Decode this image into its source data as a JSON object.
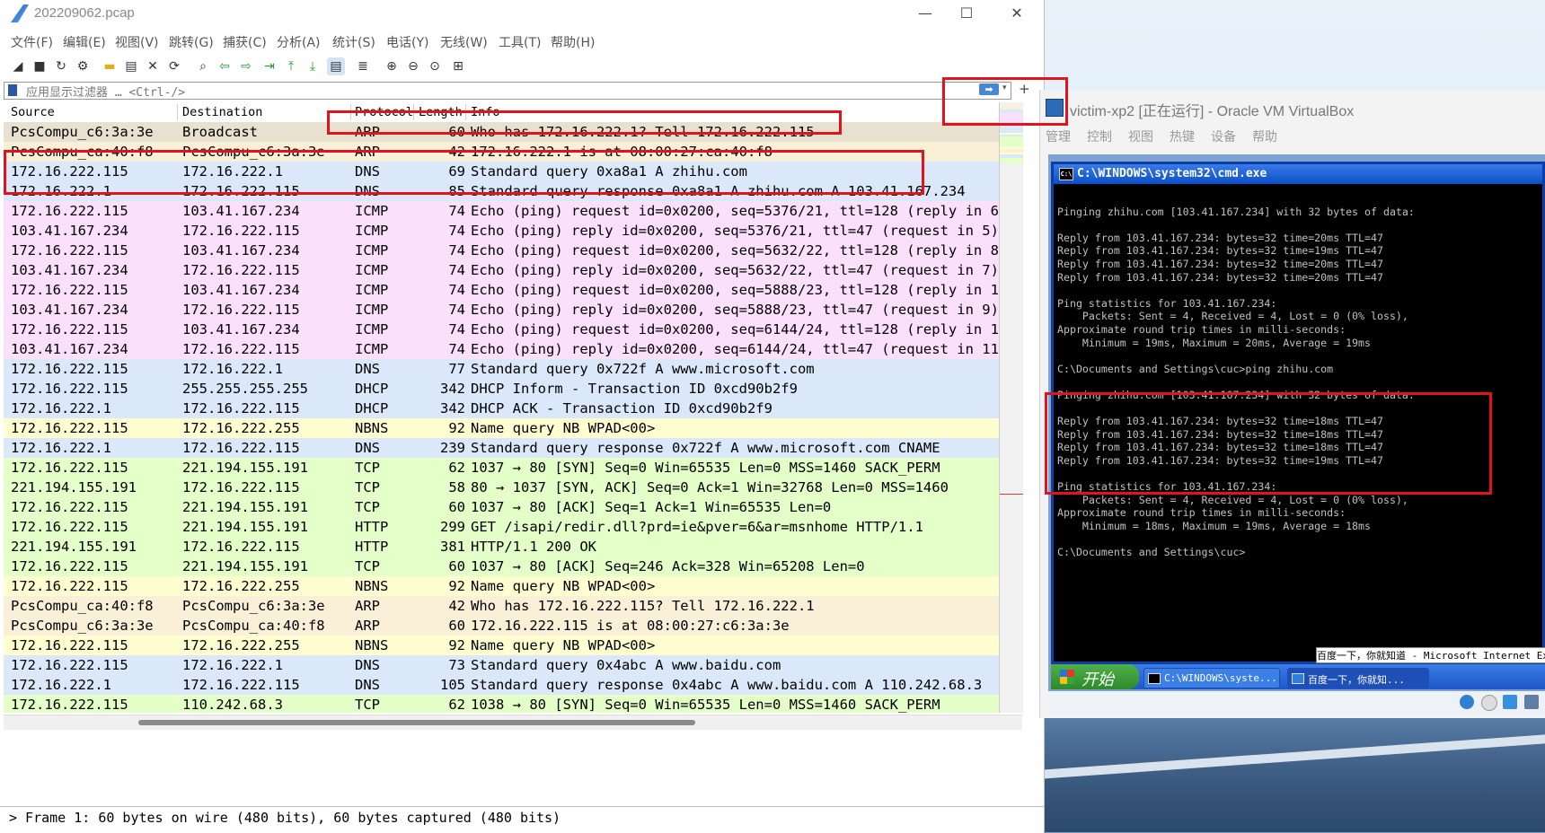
{
  "wireshark": {
    "title": "202209062.pcap",
    "window_controls": {
      "minimize": "—",
      "maximize": "☐",
      "close": "✕"
    },
    "menu": [
      "文件(F)",
      "编辑(E)",
      "视图(V)",
      "跳转(G)",
      "捕获(C)",
      "分析(A)",
      "统计(S)",
      "电话(Y)",
      "无线(W)",
      "工具(T)",
      "帮助(H)"
    ],
    "toolbar_icons": [
      "shark-fin-start-icon",
      "stop-icon",
      "restart-icon",
      "options-gear-icon",
      "open-folder-icon",
      "save-file-icon",
      "close-file-icon",
      "reload-icon",
      "find-icon",
      "go-back-icon",
      "go-forward-icon",
      "go-to-packet-icon",
      "first-packet-icon",
      "last-packet-icon",
      "autoscroll-icon",
      "colorize-icon",
      "zoom-in-icon",
      "zoom-out-icon",
      "zoom-normal-icon",
      "resize-columns-icon"
    ],
    "filter": {
      "placeholder": "应用显示过滤器 … <Ctrl-/>",
      "apply_label": "➡",
      "plus": "+"
    },
    "columns": {
      "source": "Source",
      "destination": "Destination",
      "protocol": "Protocol",
      "length": "Length",
      "info": "Info"
    },
    "rows": [
      {
        "src": "PcsCompu_c6:3a:3e",
        "dst": "Broadcast",
        "proto": "ARP",
        "len": "60",
        "info": "Who has 172.16.222.1? Tell 172.16.222.115",
        "color": "#faf0d7"
      },
      {
        "src": "PcsCompu_ca:40:f8",
        "dst": "PcsCompu_c6:3a:3e",
        "proto": "ARP",
        "len": "42",
        "info": "172.16.222.1 is at 08:00:27:ca:40:f8",
        "color": "#faf0d7"
      },
      {
        "src": "172.16.222.115",
        "dst": "172.16.222.1",
        "proto": "DNS",
        "len": "69",
        "info": "Standard query 0xa8a1 A zhihu.com",
        "color": "#dae8f9"
      },
      {
        "src": "172.16.222.1",
        "dst": "172.16.222.115",
        "proto": "DNS",
        "len": "85",
        "info": "Standard query response 0xa8a1 A zhihu.com A 103.41.167.234",
        "color": "#dae8f9"
      },
      {
        "src": "172.16.222.115",
        "dst": "103.41.167.234",
        "proto": "ICMP",
        "len": "74",
        "info": "Echo (ping) request  id=0x0200, seq=5376/21, ttl=128 (reply in 6)",
        "color": "#fbe0fb"
      },
      {
        "src": "103.41.167.234",
        "dst": "172.16.222.115",
        "proto": "ICMP",
        "len": "74",
        "info": "Echo (ping) reply    id=0x0200, seq=5376/21, ttl=47 (request in 5)",
        "color": "#fbe0fb"
      },
      {
        "src": "172.16.222.115",
        "dst": "103.41.167.234",
        "proto": "ICMP",
        "len": "74",
        "info": "Echo (ping) request  id=0x0200, seq=5632/22, ttl=128 (reply in 8)",
        "color": "#fbe0fb"
      },
      {
        "src": "103.41.167.234",
        "dst": "172.16.222.115",
        "proto": "ICMP",
        "len": "74",
        "info": "Echo (ping) reply    id=0x0200, seq=5632/22, ttl=47 (request in 7)",
        "color": "#fbe0fb"
      },
      {
        "src": "172.16.222.115",
        "dst": "103.41.167.234",
        "proto": "ICMP",
        "len": "74",
        "info": "Echo (ping) request  id=0x0200, seq=5888/23, ttl=128 (reply in 10)",
        "color": "#fbe0fb"
      },
      {
        "src": "103.41.167.234",
        "dst": "172.16.222.115",
        "proto": "ICMP",
        "len": "74",
        "info": "Echo (ping) reply    id=0x0200, seq=5888/23, ttl=47 (request in 9)",
        "color": "#fbe0fb"
      },
      {
        "src": "172.16.222.115",
        "dst": "103.41.167.234",
        "proto": "ICMP",
        "len": "74",
        "info": "Echo (ping) request  id=0x0200, seq=6144/24, ttl=128 (reply in 12)",
        "color": "#fbe0fb"
      },
      {
        "src": "103.41.167.234",
        "dst": "172.16.222.115",
        "proto": "ICMP",
        "len": "74",
        "info": "Echo (ping) reply    id=0x0200, seq=6144/24, ttl=47 (request in 11)",
        "color": "#fbe0fb"
      },
      {
        "src": "172.16.222.115",
        "dst": "172.16.222.1",
        "proto": "DNS",
        "len": "77",
        "info": "Standard query 0x722f A www.microsoft.com",
        "color": "#dae8f9"
      },
      {
        "src": "172.16.222.115",
        "dst": "255.255.255.255",
        "proto": "DHCP",
        "len": "342",
        "info": "DHCP Inform    - Transaction ID 0xcd90b2f9",
        "color": "#dae8f9"
      },
      {
        "src": "172.16.222.1",
        "dst": "172.16.222.115",
        "proto": "DHCP",
        "len": "342",
        "info": "DHCP ACK       - Transaction ID 0xcd90b2f9",
        "color": "#dae8f9"
      },
      {
        "src": "172.16.222.115",
        "dst": "172.16.222.255",
        "proto": "NBNS",
        "len": "92",
        "info": "Name query NB WPAD<00>",
        "color": "#fefed0"
      },
      {
        "src": "172.16.222.1",
        "dst": "172.16.222.115",
        "proto": "DNS",
        "len": "239",
        "info": "Standard query response 0x722f A www.microsoft.com CNAME",
        "color": "#dae8f9"
      },
      {
        "src": "172.16.222.115",
        "dst": "221.194.155.191",
        "proto": "TCP",
        "len": "62",
        "info": "1037 → 80 [SYN] Seq=0 Win=65535 Len=0 MSS=1460 SACK_PERM",
        "color": "#e4ffc7"
      },
      {
        "src": "221.194.155.191",
        "dst": "172.16.222.115",
        "proto": "TCP",
        "len": "58",
        "info": "80 → 1037 [SYN, ACK] Seq=0 Ack=1 Win=32768 Len=0 MSS=1460",
        "color": "#e4ffc7"
      },
      {
        "src": "172.16.222.115",
        "dst": "221.194.155.191",
        "proto": "TCP",
        "len": "60",
        "info": "1037 → 80 [ACK] Seq=1 Ack=1 Win=65535 Len=0",
        "color": "#e4ffc7"
      },
      {
        "src": "172.16.222.115",
        "dst": "221.194.155.191",
        "proto": "HTTP",
        "len": "299",
        "info": "GET /isapi/redir.dll?prd=ie&pver=6&ar=msnhome HTTP/1.1",
        "color": "#e4ffc7"
      },
      {
        "src": "221.194.155.191",
        "dst": "172.16.222.115",
        "proto": "HTTP",
        "len": "381",
        "info": "HTTP/1.1 200 OK",
        "color": "#e4ffc7"
      },
      {
        "src": "172.16.222.115",
        "dst": "221.194.155.191",
        "proto": "TCP",
        "len": "60",
        "info": "1037 → 80 [ACK] Seq=246 Ack=328 Win=65208 Len=0",
        "color": "#e4ffc7"
      },
      {
        "src": "172.16.222.115",
        "dst": "172.16.222.255",
        "proto": "NBNS",
        "len": "92",
        "info": "Name query NB WPAD<00>",
        "color": "#fefed0"
      },
      {
        "src": "PcsCompu_ca:40:f8",
        "dst": "PcsCompu_c6:3a:3e",
        "proto": "ARP",
        "len": "42",
        "info": "Who has 172.16.222.115? Tell 172.16.222.1",
        "color": "#faf0d7"
      },
      {
        "src": "PcsCompu_c6:3a:3e",
        "dst": "PcsCompu_ca:40:f8",
        "proto": "ARP",
        "len": "60",
        "info": "172.16.222.115 is at 08:00:27:c6:3a:3e",
        "color": "#faf0d7"
      },
      {
        "src": "172.16.222.115",
        "dst": "172.16.222.255",
        "proto": "NBNS",
        "len": "92",
        "info": "Name query NB WPAD<00>",
        "color": "#fefed0"
      },
      {
        "src": "172.16.222.115",
        "dst": "172.16.222.1",
        "proto": "DNS",
        "len": "73",
        "info": "Standard query 0x4abc A www.baidu.com",
        "color": "#dae8f9"
      },
      {
        "src": "172.16.222.1",
        "dst": "172.16.222.115",
        "proto": "DNS",
        "len": "105",
        "info": "Standard query response 0x4abc A www.baidu.com A 110.242.68.3",
        "color": "#dae8f9"
      },
      {
        "src": "172.16.222.115",
        "dst": "110.242.68.3",
        "proto": "TCP",
        "len": "62",
        "info": "1038 → 80 [SYN] Seq=0 Win=65535 Len=0 MSS=1460 SACK_PERM",
        "color": "#e4ffc7"
      }
    ],
    "selected_row_color": "#e9e1cf",
    "detail": "> Frame 1: 60 bytes on wire (480 bits), 60 bytes captured (480 bits)"
  },
  "virtualbox": {
    "title": "victim-xp2 [正在运行] - Oracle VM VirtualBox",
    "menu": [
      "管理",
      "控制",
      "视图",
      "热键",
      "设备",
      "帮助"
    ],
    "cmd_title": "C:\\WINDOWS\\system32\\cmd.exe",
    "cmd_lines": [
      "",
      "Pinging zhihu.com [103.41.167.234] with 32 bytes of data:",
      "",
      "Reply from 103.41.167.234: bytes=32 time=20ms TTL=47",
      "Reply from 103.41.167.234: bytes=32 time=19ms TTL=47",
      "Reply from 103.41.167.234: bytes=32 time=20ms TTL=47",
      "Reply from 103.41.167.234: bytes=32 time=20ms TTL=47",
      "",
      "Ping statistics for 103.41.167.234:",
      "    Packets: Sent = 4, Received = 4, Lost = 0 (0% loss),",
      "Approximate round trip times in milli-seconds:",
      "    Minimum = 19ms, Maximum = 20ms, Average = 19ms",
      "",
      "C:\\Documents and Settings\\cuc>ping zhihu.com",
      "",
      "Pinging zhihu.com [103.41.167.234] with 32 bytes of data:",
      "",
      "Reply from 103.41.167.234: bytes=32 time=18ms TTL=47",
      "Reply from 103.41.167.234: bytes=32 time=18ms TTL=47",
      "Reply from 103.41.167.234: bytes=32 time=18ms TTL=47",
      "Reply from 103.41.167.234: bytes=32 time=19ms TTL=47",
      "",
      "Ping statistics for 103.41.167.234:",
      "    Packets: Sent = 4, Received = 4, Lost = 0 (0% loss),",
      "Approximate round trip times in milli-seconds:",
      "    Minimum = 18ms, Maximum = 19ms, Average = 18ms",
      "",
      "C:\\Documents and Settings\\cuc>"
    ],
    "ie_tooltip": "百度一下，你就知道 - Microsoft Internet Explorer",
    "start_label": "开始",
    "task_cmd": "C:\\WINDOWS\\syste...",
    "task_ie": "百度一下，你就知...",
    "status_icons": [
      "usb-icon",
      "optical-drive-icon",
      "network-icon",
      "shared-folder-icon"
    ]
  },
  "colors": {
    "highlight_box": "#e0141e"
  }
}
